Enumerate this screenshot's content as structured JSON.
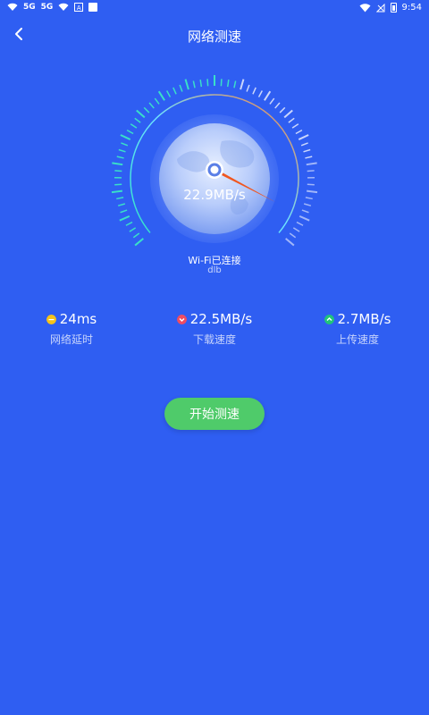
{
  "status_bar": {
    "network_1": "5G",
    "network_2": "5G",
    "time": "9:54"
  },
  "header": {
    "title": "网络测速"
  },
  "gauge": {
    "speed_text": "22.9MB/s"
  },
  "connection": {
    "status": "Wi-Fi已连接",
    "name": "dlb"
  },
  "stats": [
    {
      "value": "24ms",
      "label": "网络延时",
      "icon": "latency-icon",
      "color": "#f4c21b"
    },
    {
      "value": "22.5MB/s",
      "label": "下载速度",
      "icon": "download-icon",
      "color": "#ef4c62"
    },
    {
      "value": "2.7MB/s",
      "label": "上传速度",
      "icon": "upload-icon",
      "color": "#21c47a"
    }
  ],
  "actions": {
    "start_label": "开始测速"
  },
  "colors": {
    "background": "#2f5ef2",
    "button": "#4fcb6a",
    "needle": "#f0561f"
  }
}
